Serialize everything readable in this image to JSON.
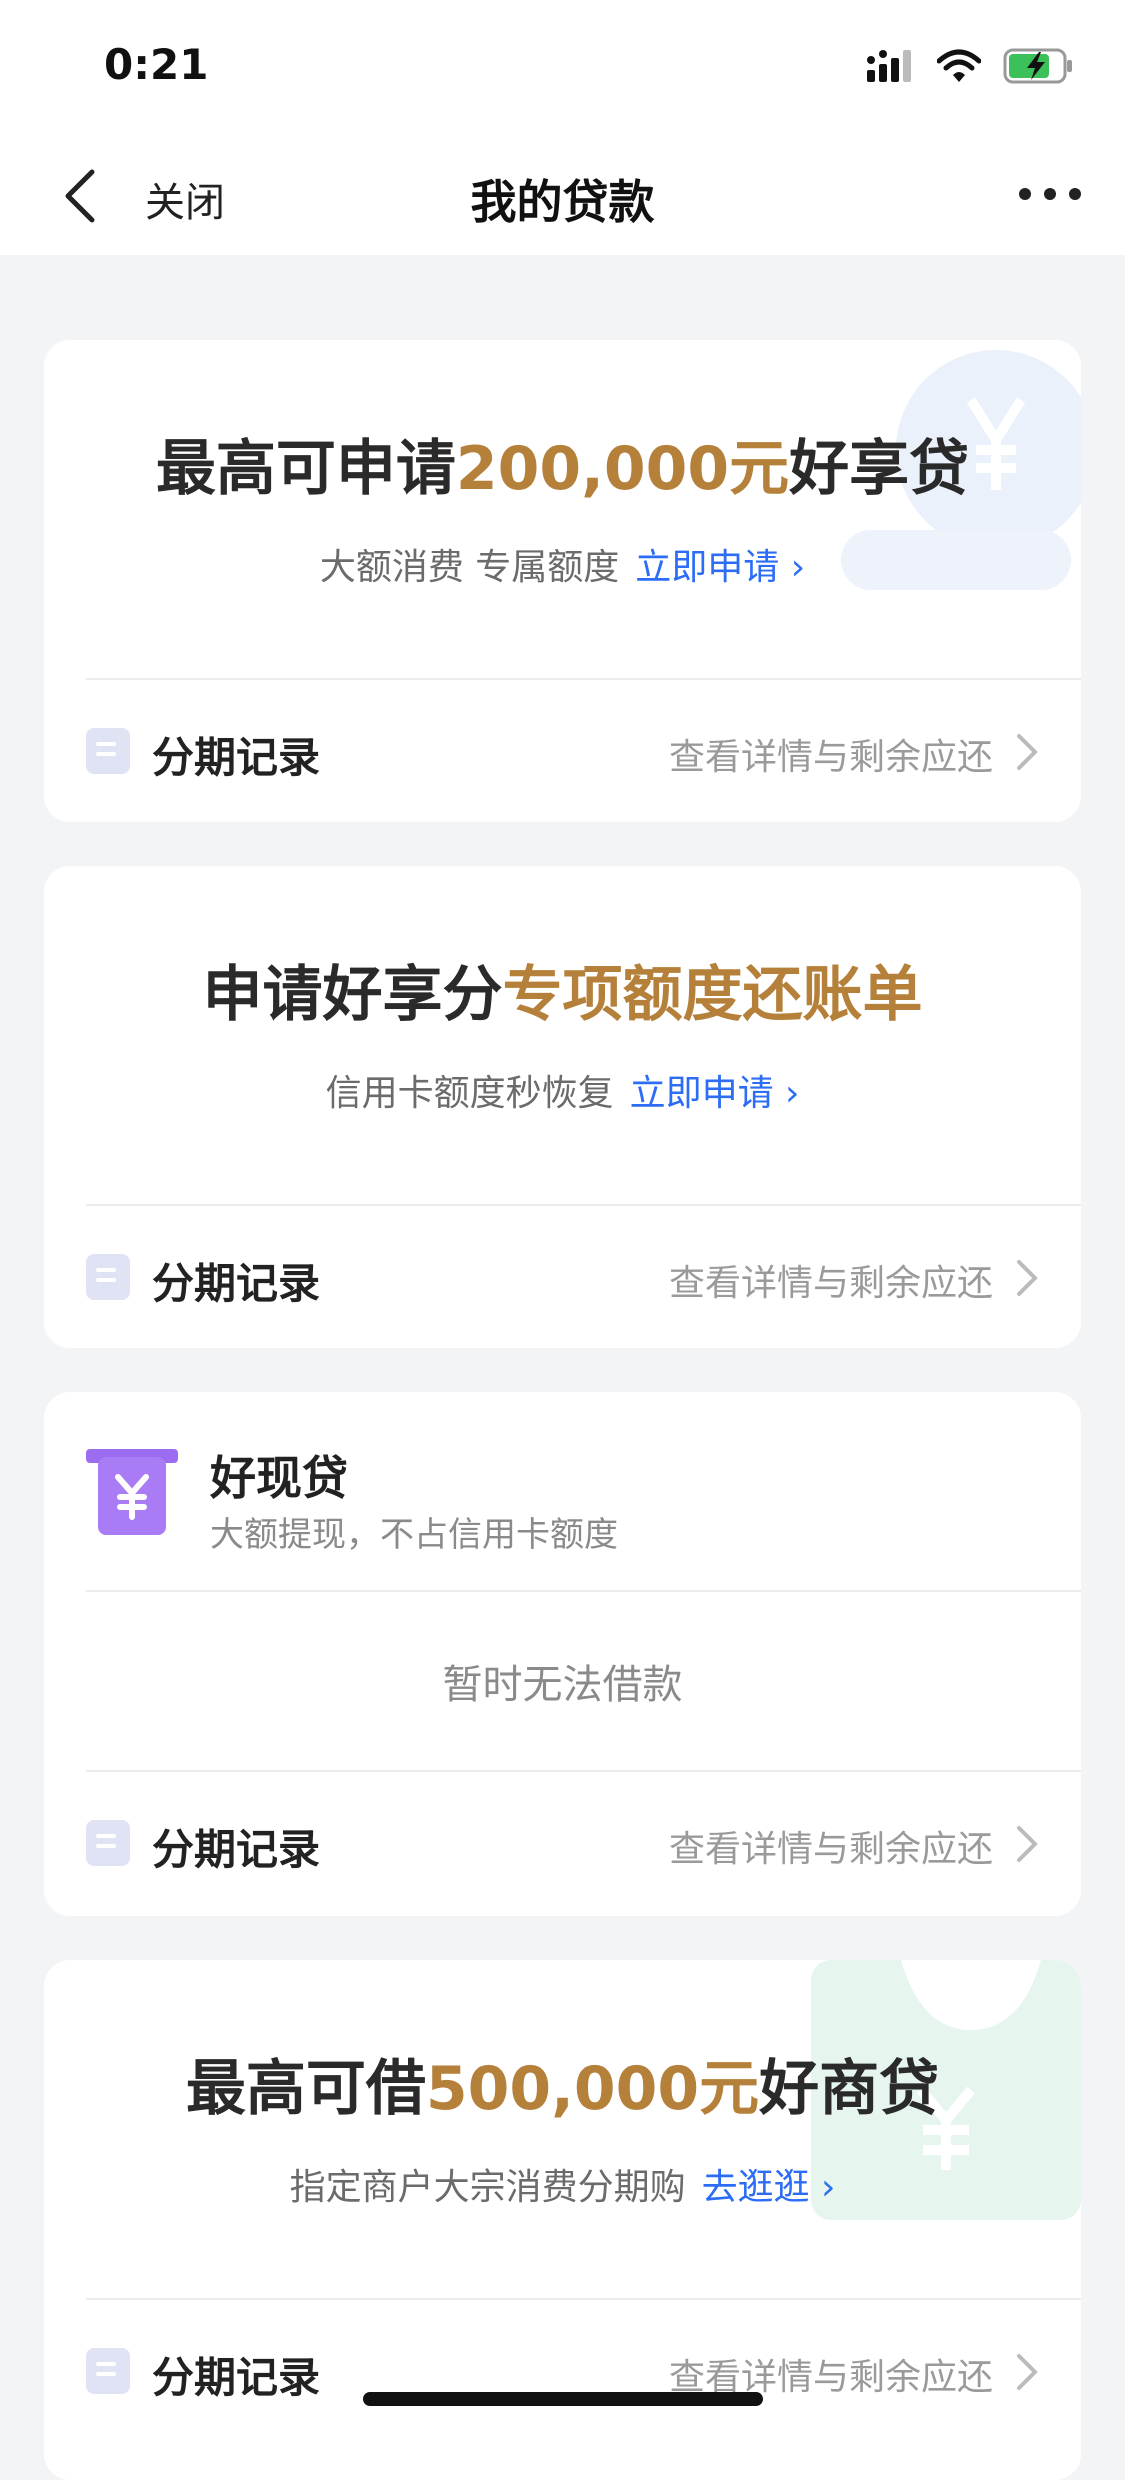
{
  "status_bar": {
    "time": "0:21"
  },
  "nav": {
    "close_label": "关闭",
    "title": "我的贷款"
  },
  "cards": [
    {
      "title_prefix": "最高可申请",
      "title_accent": "200,000元",
      "title_suffix": "好享贷",
      "subtitle": "大额消费 专属额度",
      "link": "立即申请",
      "record_label": "分期记录",
      "record_detail": "查看详情与剩余应还"
    },
    {
      "title_prefix": "申请好享分",
      "title_accent": "专项额度还账单",
      "subtitle": "信用卡额度秒恢复",
      "link": "立即申请",
      "record_label": "分期记录",
      "record_detail": "查看详情与剩余应还"
    },
    {
      "name": "好现贷",
      "desc": "大额提现，不占信用卡额度",
      "status": "暂时无法借款",
      "record_label": "分期记录",
      "record_detail": "查看详情与剩余应还"
    },
    {
      "title_prefix": "最高可借",
      "title_accent": "500,000元",
      "title_suffix": "好商贷",
      "subtitle": "指定商户大宗消费分期购",
      "link": "去逛逛",
      "record_label": "分期记录",
      "record_detail": "查看详情与剩余应还"
    }
  ],
  "colors": {
    "accent": "#b5803a",
    "link": "#2d6df6",
    "background": "#f3f4f6"
  }
}
